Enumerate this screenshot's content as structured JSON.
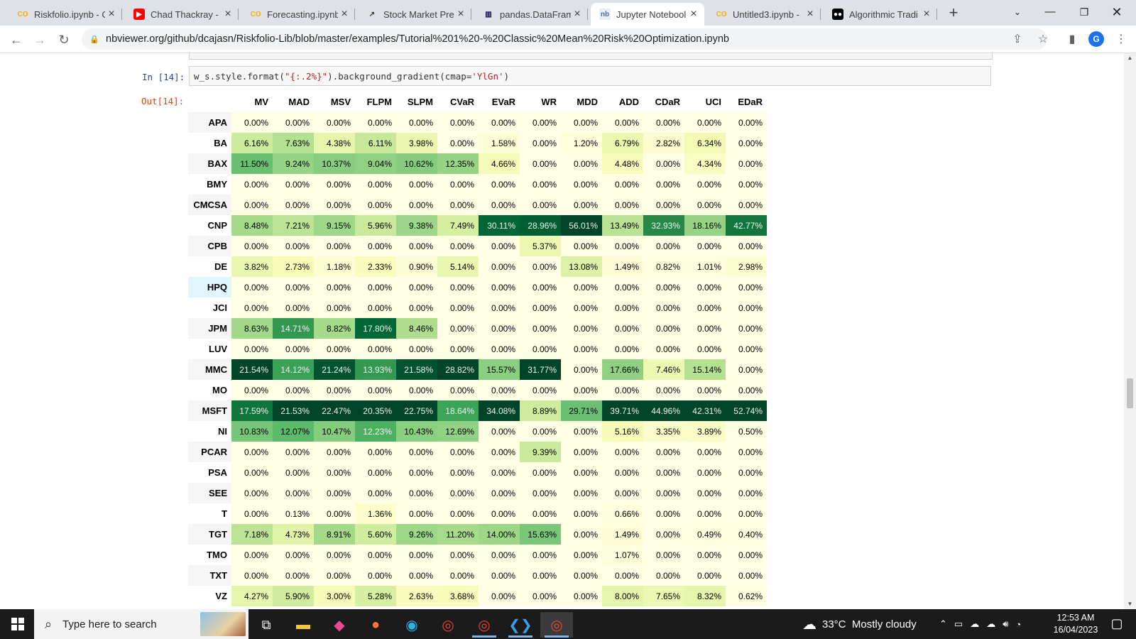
{
  "browser": {
    "tabs": [
      {
        "title": "Riskfolio.ipynb - C",
        "favicon": "colab-icon",
        "active": false
      },
      {
        "title": "Chad Thackray - Y",
        "favicon": "youtube-icon",
        "active": false
      },
      {
        "title": "Forecasting.ipynb",
        "favicon": "colab-icon",
        "active": false
      },
      {
        "title": "Stock Market Pre",
        "favicon": "chart-icon",
        "active": false
      },
      {
        "title": "pandas.DataFram",
        "favicon": "pandas-icon",
        "active": false
      },
      {
        "title": "Jupyter Notebool",
        "favicon": "nbviewer-icon",
        "active": true
      },
      {
        "title": "Untitled3.ipynb -",
        "favicon": "colab-icon",
        "active": false
      },
      {
        "title": "Algorithmic Tradi",
        "favicon": "medium-icon",
        "active": false
      }
    ],
    "url": "nbviewer.org/github/dcajasn/Riskfolio-Lib/blob/master/examples/Tutorial%201%20-%20Classic%20Mean%20Risk%20Optimization.ipynb",
    "profile_initial": "G"
  },
  "notebook": {
    "in_prompt": "In [14]:",
    "out_prompt": "Out[14]:",
    "code_prefix": "w_s.style.format(",
    "code_str1": "\"{:.2%}\"",
    "code_mid": ").background_gradient(cmap=",
    "code_str2": "'YlGn'",
    "code_suffix": ")"
  },
  "table": {
    "columns": [
      "MV",
      "MAD",
      "MSV",
      "FLPM",
      "SLPM",
      "CVaR",
      "EVaR",
      "WR",
      "MDD",
      "ADD",
      "CDaR",
      "UCI",
      "EDaR"
    ],
    "rows": [
      {
        "ticker": "APA",
        "values": [
          0,
          0,
          0,
          0,
          0,
          0,
          0,
          0,
          0,
          0,
          0,
          0,
          0
        ]
      },
      {
        "ticker": "BA",
        "values": [
          6.16,
          7.63,
          4.38,
          6.11,
          3.98,
          0,
          1.58,
          0,
          1.2,
          6.79,
          2.82,
          6.34,
          0
        ]
      },
      {
        "ticker": "BAX",
        "values": [
          11.5,
          9.24,
          10.37,
          9.04,
          10.62,
          12.35,
          4.66,
          0,
          0,
          4.48,
          0,
          4.34,
          0
        ]
      },
      {
        "ticker": "BMY",
        "values": [
          0,
          0,
          0,
          0,
          0,
          0,
          0,
          0,
          0,
          0,
          0,
          0,
          0
        ]
      },
      {
        "ticker": "CMCSA",
        "values": [
          0,
          0,
          0,
          0,
          0,
          0,
          0,
          0,
          0,
          0,
          0,
          0,
          0
        ]
      },
      {
        "ticker": "CNP",
        "values": [
          8.48,
          7.21,
          9.15,
          5.96,
          9.38,
          7.49,
          30.11,
          28.96,
          56.01,
          13.49,
          32.93,
          18.16,
          42.77
        ]
      },
      {
        "ticker": "CPB",
        "values": [
          0,
          0,
          0,
          0,
          0,
          0,
          0,
          5.37,
          0,
          0,
          0,
          0,
          0
        ]
      },
      {
        "ticker": "DE",
        "values": [
          3.82,
          2.73,
          1.18,
          2.33,
          0.9,
          5.14,
          0,
          0,
          13.08,
          1.49,
          0.82,
          1.01,
          2.98
        ]
      },
      {
        "ticker": "HPQ",
        "values": [
          0,
          0,
          0,
          0,
          0,
          0,
          0,
          0,
          0,
          0,
          0,
          0,
          0
        ]
      },
      {
        "ticker": "JCI",
        "values": [
          0,
          0,
          0,
          0,
          0,
          0,
          0,
          0,
          0,
          0,
          0,
          0,
          0
        ]
      },
      {
        "ticker": "JPM",
        "values": [
          8.63,
          14.71,
          8.82,
          17.8,
          8.46,
          0,
          0,
          0,
          0,
          0,
          0,
          0,
          0
        ]
      },
      {
        "ticker": "LUV",
        "values": [
          0,
          0,
          0,
          0,
          0,
          0,
          0,
          0,
          0,
          0,
          0,
          0,
          0
        ]
      },
      {
        "ticker": "MMC",
        "values": [
          21.54,
          14.12,
          21.24,
          13.93,
          21.58,
          28.82,
          15.57,
          31.77,
          0,
          17.66,
          7.46,
          15.14,
          0
        ]
      },
      {
        "ticker": "MO",
        "values": [
          0,
          0,
          0,
          0,
          0,
          0,
          0,
          0,
          0,
          0,
          0,
          0,
          0
        ]
      },
      {
        "ticker": "MSFT",
        "values": [
          17.59,
          21.53,
          22.47,
          20.35,
          22.75,
          18.64,
          34.08,
          8.89,
          29.71,
          39.71,
          44.96,
          42.31,
          52.74
        ]
      },
      {
        "ticker": "NI",
        "values": [
          10.83,
          12.07,
          10.47,
          12.23,
          10.43,
          12.69,
          0,
          0,
          0,
          5.16,
          3.35,
          3.89,
          0.5
        ]
      },
      {
        "ticker": "PCAR",
        "values": [
          0,
          0,
          0,
          0,
          0,
          0,
          0,
          9.39,
          0,
          0,
          0,
          0,
          0
        ]
      },
      {
        "ticker": "PSA",
        "values": [
          0,
          0,
          0,
          0,
          0,
          0,
          0,
          0,
          0,
          0,
          0,
          0,
          0
        ]
      },
      {
        "ticker": "SEE",
        "values": [
          0,
          0,
          0,
          0,
          0,
          0,
          0,
          0,
          0,
          0,
          0,
          0,
          0
        ]
      },
      {
        "ticker": "T",
        "values": [
          0,
          0.13,
          0,
          1.36,
          0,
          0,
          0,
          0,
          0,
          0.66,
          0,
          0,
          0
        ]
      },
      {
        "ticker": "TGT",
        "values": [
          7.18,
          4.73,
          8.91,
          5.6,
          9.26,
          11.2,
          14.0,
          15.63,
          0,
          1.49,
          0,
          0.49,
          0.4
        ]
      },
      {
        "ticker": "TMO",
        "values": [
          0,
          0,
          0,
          0,
          0,
          0,
          0,
          0,
          0,
          1.07,
          0,
          0,
          0
        ]
      },
      {
        "ticker": "TXT",
        "values": [
          0,
          0,
          0,
          0,
          0,
          0,
          0,
          0,
          0,
          0,
          0,
          0,
          0
        ]
      },
      {
        "ticker": "VZ",
        "values": [
          4.27,
          5.9,
          3.0,
          5.28,
          2.63,
          3.68,
          0,
          0,
          0,
          8.0,
          7.65,
          8.32,
          0.62
        ]
      }
    ],
    "hovered_row": "HPQ",
    "colormap": "YlGn"
  },
  "taskbar": {
    "search_placeholder": "Type here to search",
    "weather": "33°C  Mostly cloudy",
    "time": "12:53 AM",
    "date": "16/04/2023"
  }
}
